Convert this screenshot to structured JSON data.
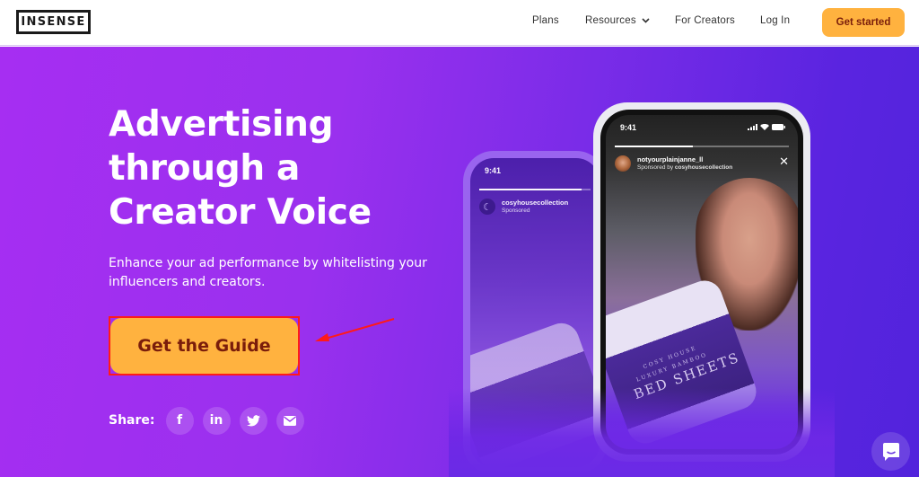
{
  "nav": {
    "logo": "INSENSE",
    "links": [
      {
        "label": "Plans"
      },
      {
        "label": "Resources",
        "has_dropdown": true
      },
      {
        "label": "For Creators"
      },
      {
        "label": "Log In"
      }
    ],
    "cta_label": "Get started"
  },
  "hero": {
    "headline_lines": [
      "Advertising",
      "through a",
      "Creator Voice"
    ],
    "subtext": "Enhance your ad performance by whitelisting your influencers and creators.",
    "cta_label": "Get the Guide",
    "share_label": "Share:",
    "share_buttons": [
      {
        "icon": "facebook-icon",
        "glyph": "f"
      },
      {
        "icon": "linkedin-icon",
        "glyph": "in"
      },
      {
        "icon": "twitter-icon",
        "glyph": ""
      },
      {
        "icon": "email-icon",
        "glyph": ""
      }
    ]
  },
  "phone_back": {
    "time": "9:41",
    "username": "cosyhousecollection",
    "subtitle": "Sponsored"
  },
  "phone_front": {
    "time": "9:41",
    "username": "notyourplainjanne_ll",
    "subtitle_prefix": "Sponsored by ",
    "subtitle_brand": "cosyhousecollection",
    "story_progress": 0.45,
    "product_brand": "COSY HOUSE",
    "product_line": "LUXURY BAMBOO",
    "product_name": "BED SHEETS"
  },
  "colors": {
    "accent": "#ffb23f",
    "accent_text": "#7a1d0b",
    "gradient_start": "#a62ef2",
    "gradient_end": "#5223dc",
    "annotation_red": "#ff1a1a"
  },
  "chat_widget": {
    "icon": "chat-icon"
  }
}
